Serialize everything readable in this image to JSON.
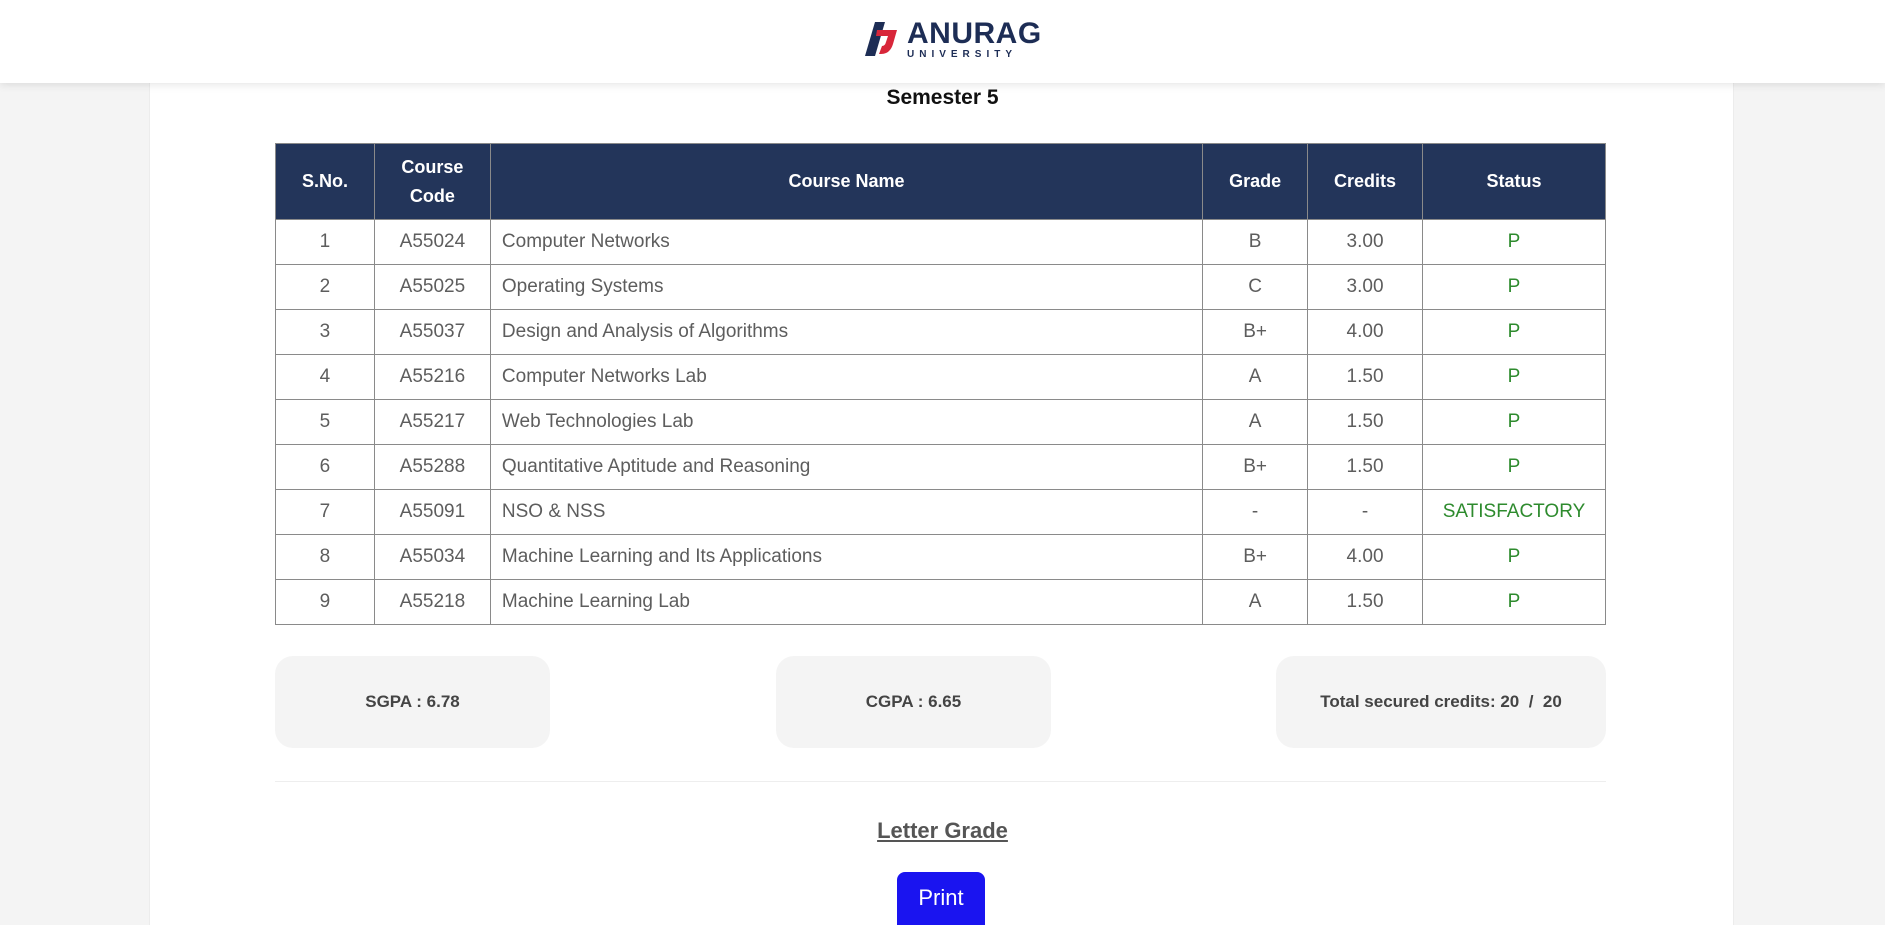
{
  "header": {
    "logo_main": "ANURAG",
    "logo_sub": "UNIVERSITY"
  },
  "semester_title": "Semester 5",
  "table": {
    "columns": [
      "S.No.",
      "Course Code",
      "Course Name",
      "Grade",
      "Credits",
      "Status"
    ],
    "rows": [
      {
        "sno": "1",
        "code": "A55024",
        "name": "Computer Networks",
        "grade": "B",
        "credits": "3.00",
        "status": "P"
      },
      {
        "sno": "2",
        "code": "A55025",
        "name": "Operating Systems",
        "grade": "C",
        "credits": "3.00",
        "status": "P"
      },
      {
        "sno": "3",
        "code": "A55037",
        "name": "Design and Analysis of Algorithms",
        "grade": "B+",
        "credits": "4.00",
        "status": "P"
      },
      {
        "sno": "4",
        "code": "A55216",
        "name": "Computer Networks Lab",
        "grade": "A",
        "credits": "1.50",
        "status": "P"
      },
      {
        "sno": "5",
        "code": "A55217",
        "name": "Web Technologies Lab",
        "grade": "A",
        "credits": "1.50",
        "status": "P"
      },
      {
        "sno": "6",
        "code": "A55288",
        "name": "Quantitative Aptitude and Reasoning",
        "grade": "B+",
        "credits": "1.50",
        "status": "P"
      },
      {
        "sno": "7",
        "code": "A55091",
        "name": "NSO & NSS",
        "grade": "-",
        "credits": "-",
        "status": "SATISFACTORY"
      },
      {
        "sno": "8",
        "code": "A55034",
        "name": "Machine Learning and Its Applications",
        "grade": "B+",
        "credits": "4.00",
        "status": "P"
      },
      {
        "sno": "9",
        "code": "A55218",
        "name": "Machine Learning Lab",
        "grade": "A",
        "credits": "1.50",
        "status": "P"
      }
    ]
  },
  "summary": {
    "sgpa": "SGPA : 6.78",
    "cgpa": "CGPA : 6.65",
    "credits": "Total secured credits: 20  /  20"
  },
  "letter_grade_label": "Letter Grade",
  "print_label": "Print",
  "colors": {
    "header_navy": "#23355a",
    "logo_red": "#d8263a",
    "status_green": "#2e8b2e",
    "print_blue": "#1a14f0"
  }
}
